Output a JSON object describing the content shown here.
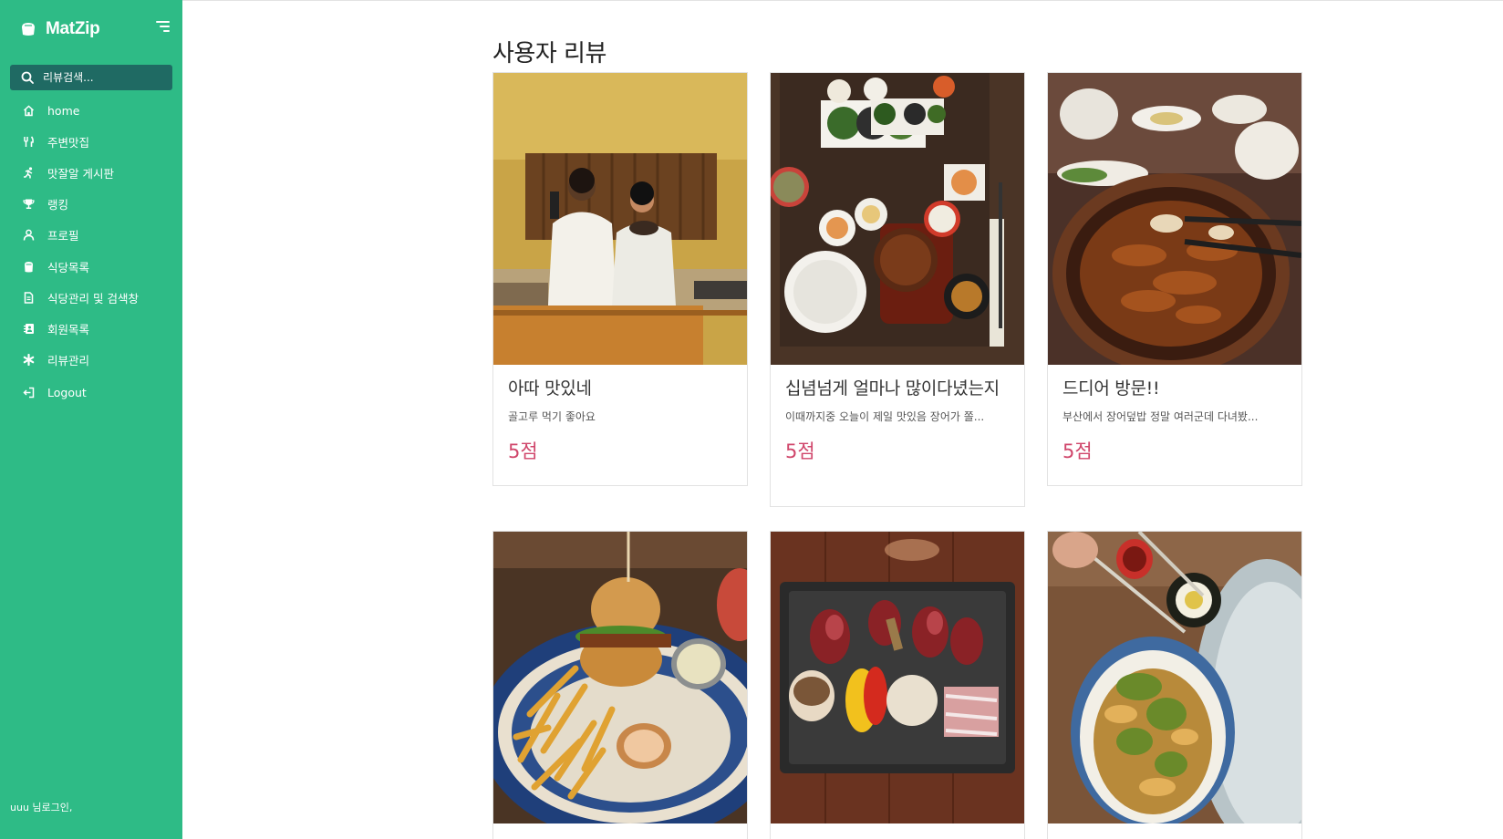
{
  "brand": {
    "name": "MatZip"
  },
  "search": {
    "placeholder": "리뷰검색..."
  },
  "nav": [
    {
      "label": "home",
      "icon": "home-icon"
    },
    {
      "label": "주변맛집",
      "icon": "utensils-icon"
    },
    {
      "label": "맛잘알 게시판",
      "icon": "running-icon"
    },
    {
      "label": "랭킹",
      "icon": "trophy-icon"
    },
    {
      "label": "프로필",
      "icon": "user-icon"
    },
    {
      "label": "식당목록",
      "icon": "store-icon"
    },
    {
      "label": "식당관리 및 검색창",
      "icon": "document-icon"
    },
    {
      "label": "회원목록",
      "icon": "address-book-icon"
    },
    {
      "label": "리뷰관리",
      "icon": "asterisk-icon"
    },
    {
      "label": "Logout",
      "icon": "logout-icon"
    }
  ],
  "greeting": "uuu 님로그인,",
  "page": {
    "title": "사용자 리뷰"
  },
  "reviews": [
    {
      "title": "아따 맛있네",
      "desc": "골고루 먹기 좋아요",
      "score": "5점",
      "photo": "chefs-photo"
    },
    {
      "title": "십념넘게 얼마나 많이다녔는지",
      "desc": "이때까지중 오늘이 제일 맛있음 장어가 쫄...",
      "score": "5점",
      "photo": "eel-set-meal-photo"
    },
    {
      "title": "드디어 방문!!",
      "desc": "부산에서 장어덮밥 정말 여러군데 다녀봤...",
      "score": "5점",
      "photo": "eel-rice-bowl-photo"
    },
    {
      "title": "",
      "desc": "",
      "score": "",
      "photo": "burger-fries-photo"
    },
    {
      "title": "",
      "desc": "",
      "score": "",
      "photo": "beef-grill-photo"
    },
    {
      "title": "",
      "desc": "",
      "score": "",
      "photo": "tempura-bowl-photo"
    }
  ],
  "colors": {
    "sidebar": "#2ebb86",
    "search_bg": "#1f6a63",
    "score": "#d0466b"
  }
}
